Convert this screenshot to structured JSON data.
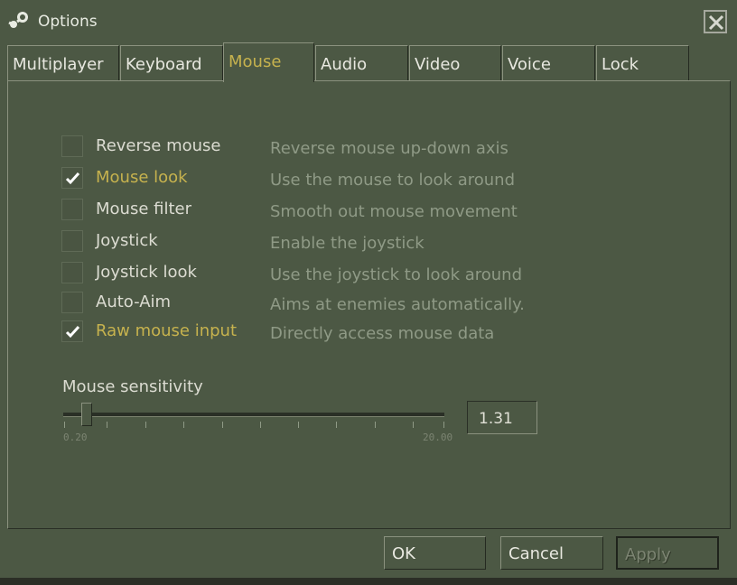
{
  "window": {
    "title": "Options"
  },
  "tabs": [
    {
      "label": "Multiplayer"
    },
    {
      "label": "Keyboard"
    },
    {
      "label": "Mouse"
    },
    {
      "label": "Audio"
    },
    {
      "label": "Video"
    },
    {
      "label": "Voice"
    },
    {
      "label": "Lock"
    }
  ],
  "active_tab": "Mouse",
  "options": [
    {
      "label": "Reverse mouse",
      "description": "Reverse mouse up-down axis",
      "checked": false
    },
    {
      "label": "Mouse look",
      "description": "Use the mouse to look around",
      "checked": true
    },
    {
      "label": "Mouse filter",
      "description": "Smooth out mouse movement",
      "checked": false
    },
    {
      "label": "Joystick",
      "description": "Enable the joystick",
      "checked": false
    },
    {
      "label": "Joystick look",
      "description": "Use the joystick to look around",
      "checked": false
    },
    {
      "label": "Auto-Aim",
      "description": "Aims at enemies automatically.",
      "checked": false
    },
    {
      "label": "Raw mouse input",
      "description": "Directly access mouse data",
      "checked": true
    }
  ],
  "sensitivity": {
    "label": "Mouse sensitivity",
    "min_label": "0.20",
    "max_label": "20.00",
    "value": "1.31"
  },
  "buttons": {
    "ok": "OK",
    "cancel": "Cancel",
    "apply": "Apply"
  },
  "colors": {
    "background": "#4c5844",
    "highlight": "#c6b24e",
    "text": "#dcdcd2",
    "muted": "#8f9a86"
  },
  "icons": {
    "app": "steam-icon",
    "close": "close-icon",
    "check": "checkmark-icon"
  }
}
